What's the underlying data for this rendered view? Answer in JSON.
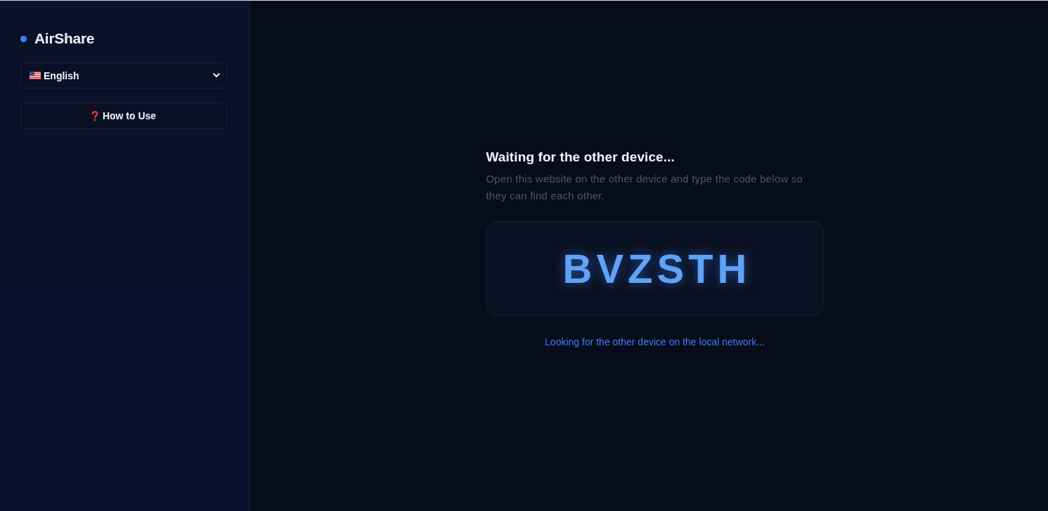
{
  "sidebar": {
    "logo": {
      "title": "AirShare"
    },
    "language_select": {
      "value": "English"
    },
    "help_button": {
      "label": "How to Use"
    }
  },
  "pairing": {
    "title": "Waiting for the other device...",
    "description": "Open this website on the other device and type the code below so they can find each other.",
    "code": "BVZSTH",
    "status": "Looking for the other device on the local network..."
  }
}
